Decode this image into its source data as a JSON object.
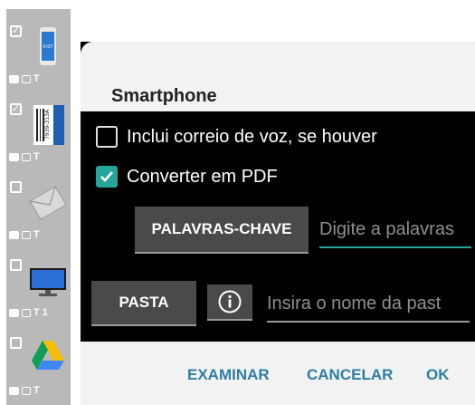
{
  "sidebar": {
    "items": [
      {
        "checked": true,
        "thumb": "smartphone-thumbnail",
        "type_label": "T",
        "extra": ""
      },
      {
        "checked": true,
        "thumb": "barcode-label-thumbnail",
        "thumb_text": "7939-313A",
        "type_label": "T",
        "extra": ""
      },
      {
        "checked": false,
        "thumb": "envelope-thumbnail",
        "type_label": "T",
        "extra": ""
      },
      {
        "checked": false,
        "thumb": "monitor-thumbnail",
        "type_label": "T",
        "extra": "1"
      },
      {
        "checked": false,
        "thumb": "google-drive-thumbnail",
        "type_label": "T",
        "extra": ""
      }
    ]
  },
  "dialog": {
    "title": "Smartphone",
    "options": [
      {
        "label": "Inclui correio de voz, se houver",
        "checked": false
      },
      {
        "label": "Converter em PDF",
        "checked": true
      }
    ],
    "keywords_button": "PALAVRAS-CHAVE",
    "keywords_placeholder": "Digite a palavras",
    "folder_button": "PASTA",
    "folder_placeholder": "Insira o nome da past",
    "actions": {
      "browse": "EXAMINAR",
      "cancel": "CANCELAR",
      "ok": "OK"
    }
  },
  "colors": {
    "accent": "#26a69a",
    "action_text": "#2e7fa3",
    "dialog_body": "#000000",
    "dialog_header": "#f2f2f2",
    "sidebar": "#b9b9b9"
  }
}
